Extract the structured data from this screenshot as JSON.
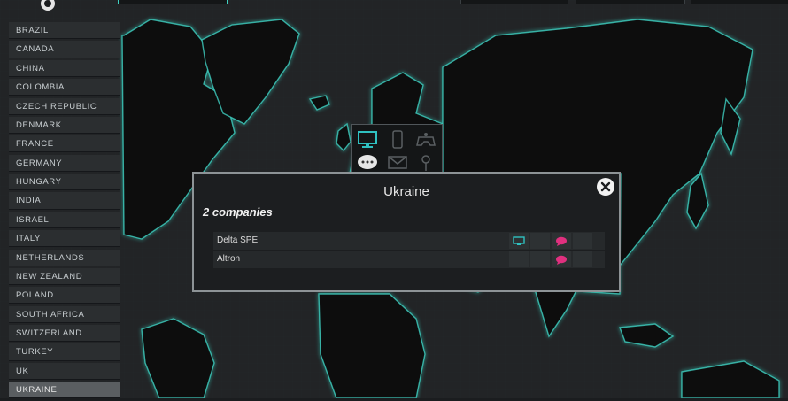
{
  "sidebar": {
    "countries": [
      "BRAZIL",
      "CANADA",
      "CHINA",
      "COLOMBIA",
      "CZECH REPUBLIC",
      "DENMARK",
      "FRANCE",
      "GERMANY",
      "HUNGARY",
      "INDIA",
      "ISRAEL",
      "ITALY",
      "NETHERLANDS",
      "NEW ZEALAND",
      "POLAND",
      "SOUTH AFRICA",
      "SWITZERLAND",
      "TURKEY",
      "UK",
      "UKRAINE"
    ],
    "selected": "UKRAINE"
  },
  "categories": [
    {
      "icon": "monitor-icon",
      "active": true
    },
    {
      "icon": "phone-icon",
      "active": false
    },
    {
      "icon": "gamepad-icon",
      "active": false
    },
    {
      "icon": "chat-bubble-icon",
      "active": true
    },
    {
      "icon": "mail-icon",
      "active": false
    },
    {
      "icon": "location-pin-icon",
      "active": false
    }
  ],
  "modal": {
    "title": "Ukraine",
    "count_text": "2 companies",
    "companies": [
      {
        "name": "Delta SPE",
        "monitor": true,
        "chat": true
      },
      {
        "name": "Altron",
        "monitor": false,
        "chat": true
      }
    ]
  },
  "colors": {
    "coast_glow": "#3fd0c0",
    "monitor_accent": "#2fc1c1",
    "chat_accent": "#e0307f",
    "land": "#0e0f10",
    "sea": "#222426"
  }
}
